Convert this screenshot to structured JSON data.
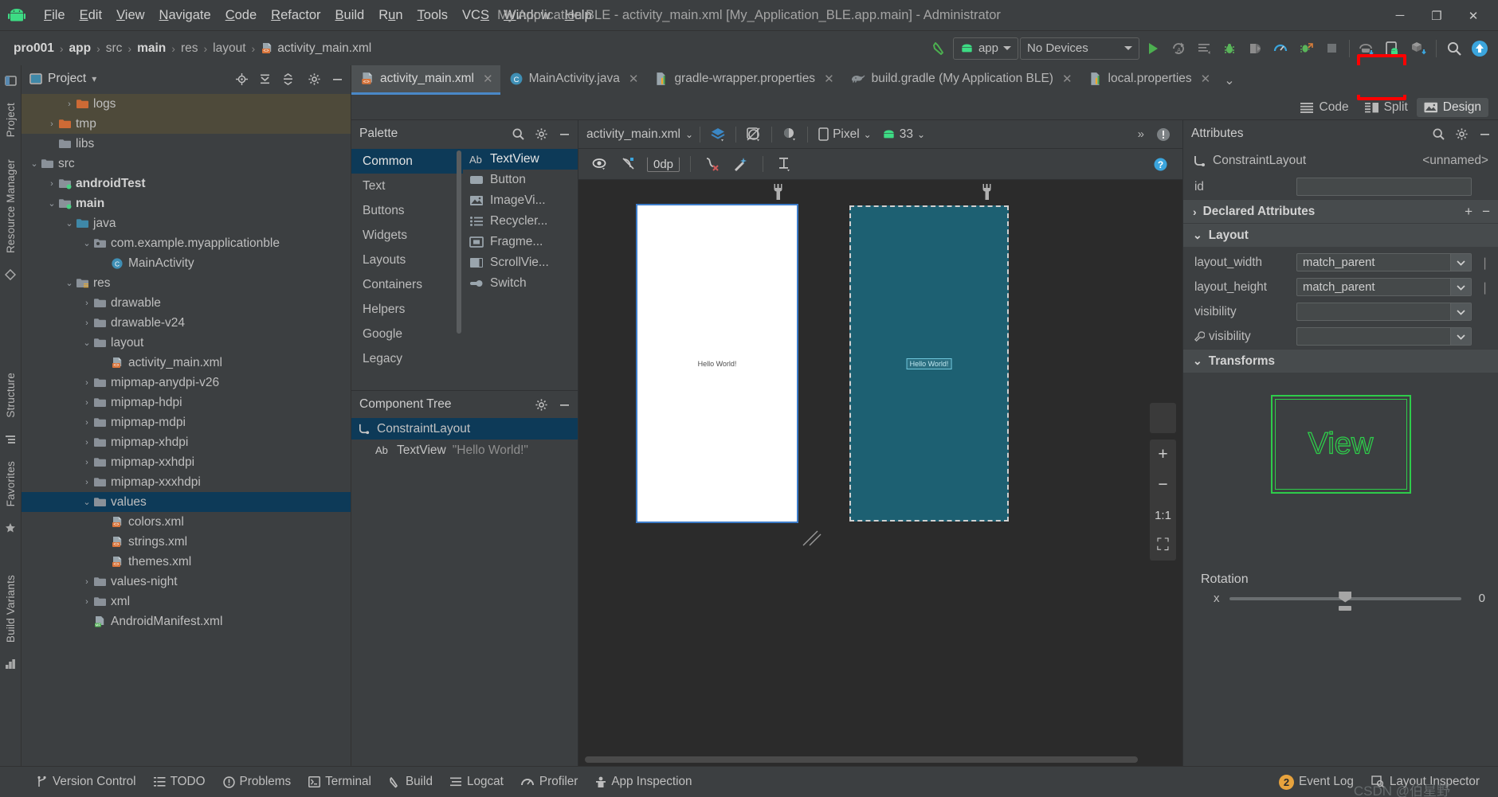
{
  "window": {
    "title": "My Application BLE - activity_main.xml [My_Application_BLE.app.main] - Administrator",
    "minimize": "─",
    "maximize": "❐",
    "close": "✕"
  },
  "menubar": {
    "logo": "android-logo-icon",
    "items": [
      {
        "pre": "",
        "u": "F",
        "post": "ile"
      },
      {
        "pre": "",
        "u": "E",
        "post": "dit"
      },
      {
        "pre": "",
        "u": "V",
        "post": "iew"
      },
      {
        "pre": "",
        "u": "N",
        "post": "avigate"
      },
      {
        "pre": "",
        "u": "C",
        "post": "ode"
      },
      {
        "pre": "",
        "u": "R",
        "post": "efactor"
      },
      {
        "pre": "",
        "u": "B",
        "post": "uild"
      },
      {
        "pre": "R",
        "u": "u",
        "post": "n"
      },
      {
        "pre": "",
        "u": "T",
        "post": "ools"
      },
      {
        "pre": "VC",
        "u": "S",
        "post": ""
      },
      {
        "pre": "",
        "u": "W",
        "post": "indow"
      },
      {
        "pre": "",
        "u": "H",
        "post": "elp"
      }
    ]
  },
  "navbar": {
    "breadcrumbs": [
      {
        "label": "pro001",
        "bold": true
      },
      {
        "label": "app",
        "bold": true
      },
      {
        "label": "src",
        "bold": false
      },
      {
        "label": "main",
        "bold": true
      },
      {
        "label": "res",
        "bold": false
      },
      {
        "label": "layout",
        "bold": false
      },
      {
        "label": "activity_main.xml",
        "bold": false,
        "icon": "xml-file-icon"
      }
    ],
    "separator": "›",
    "module_selector": "app",
    "device_selector": "No Devices",
    "actions": [
      "make-project-icon",
      "run-icon",
      "apply-changes-icon",
      "apply-code-changes-icon",
      "debug-icon",
      "attach-debugger-icon",
      "profiler-icon",
      "profile-with-debug-icon",
      "stop-icon",
      "avd-manager-icon",
      "device-manager-icon",
      "sdk-manager-icon",
      "search-icon",
      "update-icon"
    ],
    "highlighted_action": "device-manager-icon"
  },
  "left_rail": {
    "top_labels": [
      "Project",
      "Resource Manager"
    ],
    "mid_labels": [
      "Structure",
      "Favorites"
    ],
    "bottom_labels": [
      "Build Variants"
    ]
  },
  "project_panel": {
    "title": "Project",
    "dropdown": "▾",
    "toolbar_icons": [
      "locate-icon",
      "expand-all-icon",
      "collapse-all-icon",
      "settings-icon",
      "hide-icon"
    ],
    "tree": [
      {
        "label": "logs",
        "depth": 4,
        "arrow": "›",
        "icon": "folder-orange",
        "bold": false,
        "highlight": "brown"
      },
      {
        "label": "tmp",
        "depth": 3,
        "arrow": "›",
        "icon": "folder-orange",
        "bold": false,
        "highlight": "brown"
      },
      {
        "label": "libs",
        "depth": 3,
        "arrow": "",
        "icon": "folder-gray",
        "bold": false,
        "highlight": ""
      },
      {
        "label": "src",
        "depth": 2,
        "arrow": "⌄",
        "icon": "folder-gray",
        "bold": false,
        "highlight": ""
      },
      {
        "label": "androidTest",
        "depth": 3,
        "arrow": "›",
        "icon": "folder-src-green",
        "bold": true,
        "highlight": ""
      },
      {
        "label": "main",
        "depth": 3,
        "arrow": "⌄",
        "icon": "folder-src-green",
        "bold": true,
        "highlight": ""
      },
      {
        "label": "java",
        "depth": 4,
        "arrow": "⌄",
        "icon": "folder-blue",
        "bold": false,
        "highlight": ""
      },
      {
        "label": "com.example.myapplicationble",
        "depth": 5,
        "arrow": "⌄",
        "icon": "package-icon",
        "bold": false,
        "highlight": ""
      },
      {
        "label": "MainActivity",
        "depth": 6,
        "arrow": "",
        "icon": "class-icon",
        "bold": false,
        "highlight": ""
      },
      {
        "label": "res",
        "depth": 4,
        "arrow": "⌄",
        "icon": "folder-res",
        "bold": false,
        "highlight": ""
      },
      {
        "label": "drawable",
        "depth": 5,
        "arrow": "›",
        "icon": "folder-gray",
        "bold": false,
        "highlight": ""
      },
      {
        "label": "drawable-v24",
        "depth": 5,
        "arrow": "›",
        "icon": "folder-gray",
        "bold": false,
        "highlight": ""
      },
      {
        "label": "layout",
        "depth": 5,
        "arrow": "⌄",
        "icon": "folder-gray",
        "bold": false,
        "highlight": ""
      },
      {
        "label": "activity_main.xml",
        "depth": 6,
        "arrow": "",
        "icon": "xml-file-icon",
        "bold": false,
        "highlight": ""
      },
      {
        "label": "mipmap-anydpi-v26",
        "depth": 5,
        "arrow": "›",
        "icon": "folder-gray",
        "bold": false,
        "highlight": ""
      },
      {
        "label": "mipmap-hdpi",
        "depth": 5,
        "arrow": "›",
        "icon": "folder-gray",
        "bold": false,
        "highlight": ""
      },
      {
        "label": "mipmap-mdpi",
        "depth": 5,
        "arrow": "›",
        "icon": "folder-gray",
        "bold": false,
        "highlight": ""
      },
      {
        "label": "mipmap-xhdpi",
        "depth": 5,
        "arrow": "›",
        "icon": "folder-gray",
        "bold": false,
        "highlight": ""
      },
      {
        "label": "mipmap-xxhdpi",
        "depth": 5,
        "arrow": "›",
        "icon": "folder-gray",
        "bold": false,
        "highlight": ""
      },
      {
        "label": "mipmap-xxxhdpi",
        "depth": 5,
        "arrow": "›",
        "icon": "folder-gray",
        "bold": false,
        "highlight": ""
      },
      {
        "label": "values",
        "depth": 5,
        "arrow": "⌄",
        "icon": "folder-gray",
        "bold": false,
        "highlight": "blue"
      },
      {
        "label": "colors.xml",
        "depth": 6,
        "arrow": "",
        "icon": "xml-file-icon",
        "bold": false,
        "highlight": ""
      },
      {
        "label": "strings.xml",
        "depth": 6,
        "arrow": "",
        "icon": "xml-file-icon",
        "bold": false,
        "highlight": ""
      },
      {
        "label": "themes.xml",
        "depth": 6,
        "arrow": "",
        "icon": "xml-file-icon",
        "bold": false,
        "highlight": ""
      },
      {
        "label": "values-night",
        "depth": 5,
        "arrow": "›",
        "icon": "folder-gray",
        "bold": false,
        "highlight": ""
      },
      {
        "label": "xml",
        "depth": 5,
        "arrow": "›",
        "icon": "folder-gray",
        "bold": false,
        "highlight": ""
      },
      {
        "label": "AndroidManifest.xml",
        "depth": 5,
        "arrow": "",
        "icon": "manifest-icon",
        "bold": false,
        "highlight": ""
      }
    ]
  },
  "tabs": {
    "items": [
      {
        "label": "activity_main.xml",
        "icon": "xml-file-icon",
        "active": true
      },
      {
        "label": "MainActivity.java",
        "icon": "class-icon",
        "active": false
      },
      {
        "label": "gradle-wrapper.properties",
        "icon": "properties-icon",
        "active": false
      },
      {
        "label": "build.gradle (My Application BLE)",
        "icon": "gradle-icon",
        "active": false
      },
      {
        "label": "local.properties",
        "icon": "properties-icon",
        "active": false
      }
    ],
    "overflow": "⌄",
    "close_glyph": "✕"
  },
  "view_modes": {
    "items": [
      {
        "label": "Code",
        "icon": "code-lines-icon",
        "active": false
      },
      {
        "label": "Split",
        "icon": "split-icon",
        "active": false
      },
      {
        "label": "Design",
        "icon": "design-image-icon",
        "active": true
      }
    ]
  },
  "palette": {
    "title": "Palette",
    "header_icons": [
      "search-icon",
      "settings-icon",
      "hide-icon"
    ],
    "categories": [
      {
        "label": "Common",
        "active": true
      },
      {
        "label": "Text",
        "active": false
      },
      {
        "label": "Buttons",
        "active": false
      },
      {
        "label": "Widgets",
        "active": false
      },
      {
        "label": "Layouts",
        "active": false
      },
      {
        "label": "Containers",
        "active": false
      },
      {
        "label": "Helpers",
        "active": false
      },
      {
        "label": "Google",
        "active": false
      },
      {
        "label": "Legacy",
        "active": false
      }
    ],
    "items": [
      {
        "label": "TextView",
        "icon": "ab-text-icon",
        "active": true
      },
      {
        "label": "Button",
        "icon": "button-icon",
        "active": false
      },
      {
        "label": "ImageVi...",
        "icon": "image-icon",
        "active": false
      },
      {
        "label": "Recycler...",
        "icon": "list-icon",
        "active": false
      },
      {
        "label": "Fragme...",
        "icon": "fragment-icon",
        "active": false
      },
      {
        "label": "ScrollVie...",
        "icon": "scrollview-icon",
        "active": false
      },
      {
        "label": "Switch",
        "icon": "switch-icon",
        "active": false
      }
    ]
  },
  "component_tree": {
    "title": "Component Tree",
    "header_icons": [
      "settings-icon",
      "hide-icon"
    ],
    "nodes": [
      {
        "label": "ConstraintLayout",
        "icon": "constraint-layout-icon",
        "hint": "",
        "selected": true,
        "indent": false
      },
      {
        "label": "TextView",
        "icon": "ab-text-icon",
        "hint": "\"Hello World!\"",
        "selected": false,
        "indent": true
      }
    ]
  },
  "design_toolbar": {
    "file_name": "activity_main.xml",
    "dropdown": "⌄",
    "icons": [
      "layers-icon",
      "orientation-icon",
      "theme-icon"
    ],
    "device": "Pixel",
    "api_level": "33",
    "overflow": "»",
    "warning": "issues-icon"
  },
  "design_toolbar2": {
    "icons": [
      "eye-icon",
      "no-constraints-icon",
      "clear-constraints-icon",
      "infer-constraints-icon",
      "margin-icon"
    ],
    "margin_value": "0dp",
    "help": "?"
  },
  "canvas": {
    "devices": [
      {
        "name": "design-preview",
        "label": "Hello World!",
        "selected": true,
        "theme": "light"
      },
      {
        "name": "blueprint-preview",
        "label": "Hello World!",
        "selected": false,
        "theme": "dark"
      }
    ],
    "zoom_controls": [
      {
        "label": "+",
        "name": "zoom-in-button"
      },
      {
        "label": "−",
        "name": "zoom-out-button"
      },
      {
        "label": "1:1",
        "name": "zoom-actual-button"
      },
      {
        "label": "⛶",
        "name": "zoom-fit-button"
      }
    ]
  },
  "attributes": {
    "title": "Attributes",
    "header_icons": [
      "search-icon",
      "settings-icon",
      "hide-icon"
    ],
    "component": "ConstraintLayout",
    "component_id": "<unnamed>",
    "id_label": "id",
    "id_value": "",
    "sections": [
      {
        "label": "Declared Attributes",
        "expanded": false,
        "arrow": "›",
        "add": "+",
        "remove": "−"
      },
      {
        "label": "Layout",
        "expanded": true,
        "arrow": "⌄"
      },
      {
        "label": "Transforms",
        "expanded": true,
        "arrow": "⌄"
      }
    ],
    "layout_rows": [
      {
        "name": "layout_width",
        "value": "match_parent",
        "wrench": false
      },
      {
        "name": "layout_height",
        "value": "match_parent",
        "wrench": false
      },
      {
        "name": "visibility",
        "value": "",
        "wrench": false
      },
      {
        "name": "visibility",
        "value": "",
        "wrench": true
      }
    ],
    "transforms": {
      "view_label": "View",
      "rotation_title": "Rotation",
      "rows": [
        {
          "axis": "x",
          "value": "0"
        }
      ]
    }
  },
  "statusbar": {
    "items": [
      {
        "label": "Version Control",
        "icon": "branch-icon"
      },
      {
        "label": "TODO",
        "icon": "todo-icon"
      },
      {
        "label": "Problems",
        "icon": "problems-icon"
      },
      {
        "label": "Terminal",
        "icon": "terminal-icon"
      },
      {
        "label": "Build",
        "icon": "build-icon"
      },
      {
        "label": "Logcat",
        "icon": "logcat-icon"
      },
      {
        "label": "Profiler",
        "icon": "profiler-icon"
      },
      {
        "label": "App Inspection",
        "icon": "inspection-icon"
      }
    ],
    "right": [
      {
        "label": "Event Log",
        "icon": "event-log-icon",
        "badge": "2"
      },
      {
        "label": "Layout Inspector",
        "icon": "layout-inspector-icon",
        "badge": ""
      }
    ],
    "watermark": "CSDN @伯星野"
  },
  "colors": {
    "accent_blue": "#4a88c7",
    "selection_blue": "#0d3a58",
    "highlight_brown": "#4e4a3a",
    "green": "#2ecc4a",
    "blueprint": "#1d6072",
    "red_highlight": "#ff0000",
    "badge_orange": "#e8a33d"
  }
}
